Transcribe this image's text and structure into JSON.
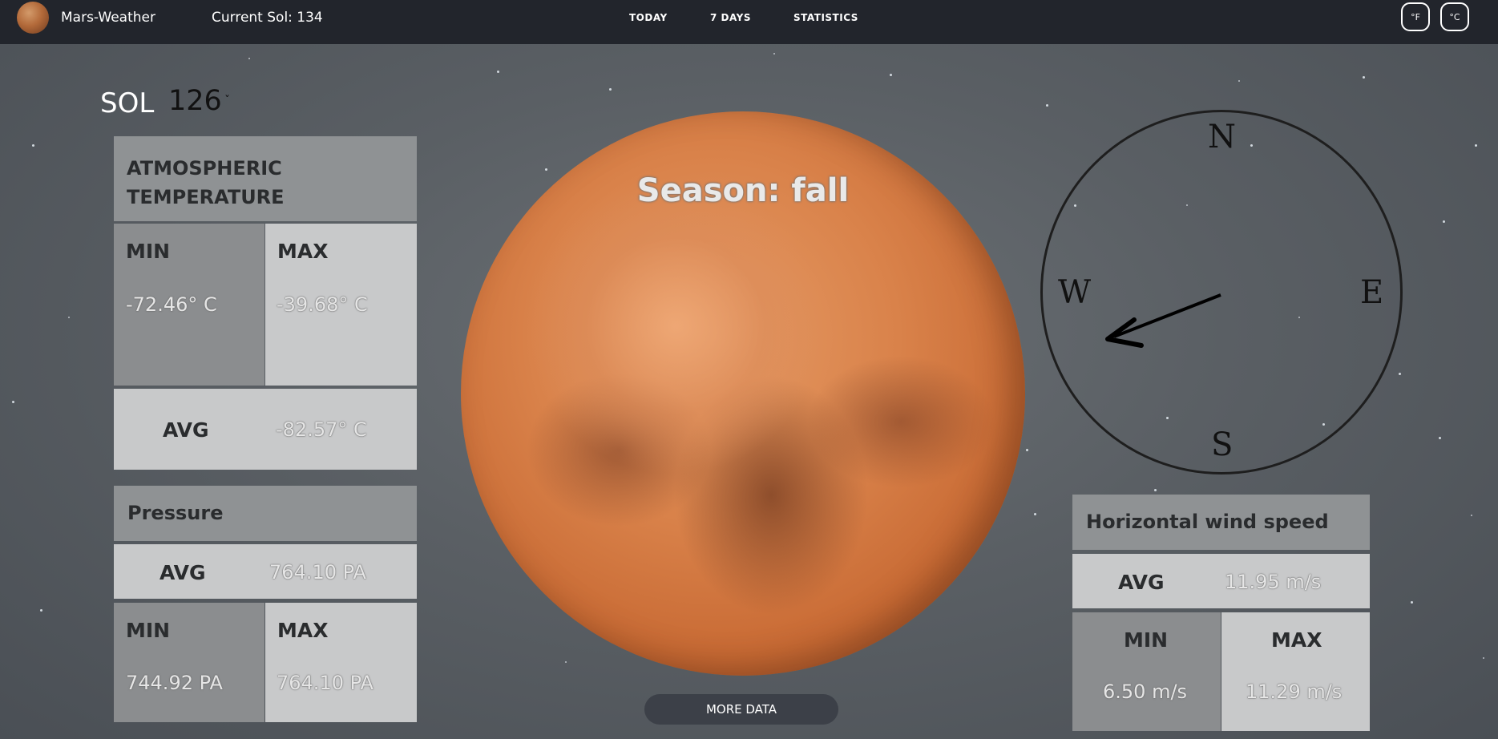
{
  "header": {
    "app_title": "Mars-Weather",
    "current_sol": "Current Sol: 134",
    "nav": [
      "TODAY",
      "7 DAYS",
      "STATISTICS"
    ],
    "units": [
      "°F",
      "°C"
    ]
  },
  "sol": {
    "label": "SOL",
    "value": "126",
    "caret": "ˇ"
  },
  "temperature": {
    "title_line1": "ATMOSPHERIC",
    "title_line2": "TEMPERATURE",
    "min_label": "MIN",
    "min_value": "-72.46° C",
    "max_label": "MAX",
    "max_value": "-39.68° C",
    "avg_label": "AVG",
    "avg_value": "-82.57° C"
  },
  "pressure": {
    "title": "Pressure",
    "avg_label": "AVG",
    "avg_value": "764.10 PA",
    "min_label": "MIN",
    "min_value": "744.92 PA",
    "max_label": "MAX",
    "max_value": "764.10 PA"
  },
  "season": "Season: fall",
  "more_data": "MORE DATA",
  "compass": {
    "n": "N",
    "e": "E",
    "s": "S",
    "w": "W"
  },
  "wind": {
    "title": "Horizontal wind speed",
    "avg_label": "AVG",
    "avg_value": "11.95 m/s",
    "min_label": "MIN",
    "min_value": "6.50 m/s",
    "max_label": "MAX",
    "max_value": "11.29 m/s"
  }
}
